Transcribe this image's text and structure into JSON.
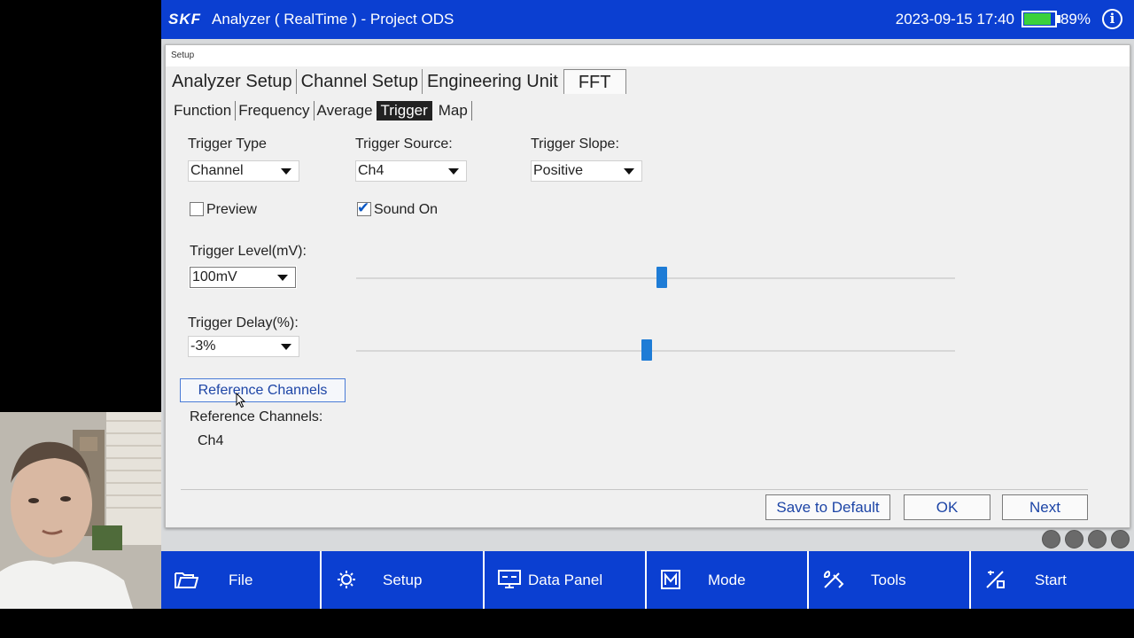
{
  "titlebar": {
    "logo": "SKF",
    "title": "Analyzer ( RealTime ) - Project ODS",
    "datetime": "2023-09-15 17:40",
    "battery_percent": "89%",
    "battery_level": 0.89,
    "info_icon": "info-icon"
  },
  "dialog": {
    "caption": "Setup",
    "main_tabs": [
      "Analyzer Setup",
      "Channel Setup",
      "Engineering Unit",
      "FFT"
    ],
    "active_main_tab": "FFT",
    "sub_tabs": [
      "Function",
      "Frequency",
      "Average",
      "Trigger",
      "Map"
    ],
    "active_sub_tab": "Trigger",
    "trigger_type": {
      "label": "Trigger Type",
      "value": "Channel"
    },
    "trigger_source": {
      "label": "Trigger Source:",
      "value": "Ch4"
    },
    "trigger_slope": {
      "label": "Trigger Slope:",
      "value": "Positive"
    },
    "preview": {
      "label": "Preview",
      "checked": false
    },
    "sound_on": {
      "label": "Sound On",
      "checked": true
    },
    "trigger_level": {
      "label": "Trigger Level(mV):",
      "value": "100mV",
      "slider_fraction": 0.51
    },
    "trigger_delay": {
      "label": "Trigger Delay(%):",
      "value": "-3%",
      "slider_fraction": 0.485
    },
    "reference_button": "Reference Channels",
    "reference_label": "Reference Channels:",
    "reference_value": "Ch4",
    "buttons": {
      "save_default": "Save to Default",
      "ok": "OK",
      "next": "Next"
    }
  },
  "nav": [
    {
      "label": "File",
      "icon": "folder-icon"
    },
    {
      "label": "Setup",
      "icon": "setup-gear-icon"
    },
    {
      "label": "Data Panel",
      "icon": "data-panel-icon"
    },
    {
      "label": "Mode",
      "icon": "mode-icon"
    },
    {
      "label": "Tools",
      "icon": "tools-icon"
    },
    {
      "label": "Start",
      "icon": "start-icon"
    }
  ],
  "colors": {
    "brand_blue": "#0b3fd1",
    "slider_thumb": "#1e7cd6",
    "battery_green": "#3bd13b"
  }
}
